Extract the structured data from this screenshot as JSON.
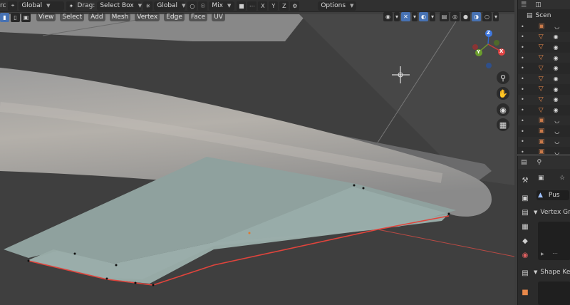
{
  "header": {
    "mode_prefix": "rc",
    "orientation": "Global",
    "drag_label": "Drag:",
    "select_mode": "Select Box",
    "pivot": "Global",
    "proportional": "Mix",
    "axes": [
      "X",
      "Y",
      "Z"
    ],
    "options": "Options"
  },
  "menubar": {
    "items": [
      "View",
      "Select",
      "Add",
      "Mesh",
      "Vertex",
      "Edge",
      "Face",
      "UV"
    ]
  },
  "gizmo": {
    "z": "Z",
    "x": "X",
    "y": "Y"
  },
  "outliner": {
    "scene_label": "Scen",
    "search_icon": "search-icon"
  },
  "properties": {
    "object_name": "Pus",
    "vertex_groups": "Vertex Gr",
    "shape_keys": "Shape Ke"
  },
  "colors": {
    "accent": "#4772b3",
    "selection_edge": "#e0443c",
    "mesh_icon": "#e8884a",
    "wing_face": "#8fa19e"
  }
}
